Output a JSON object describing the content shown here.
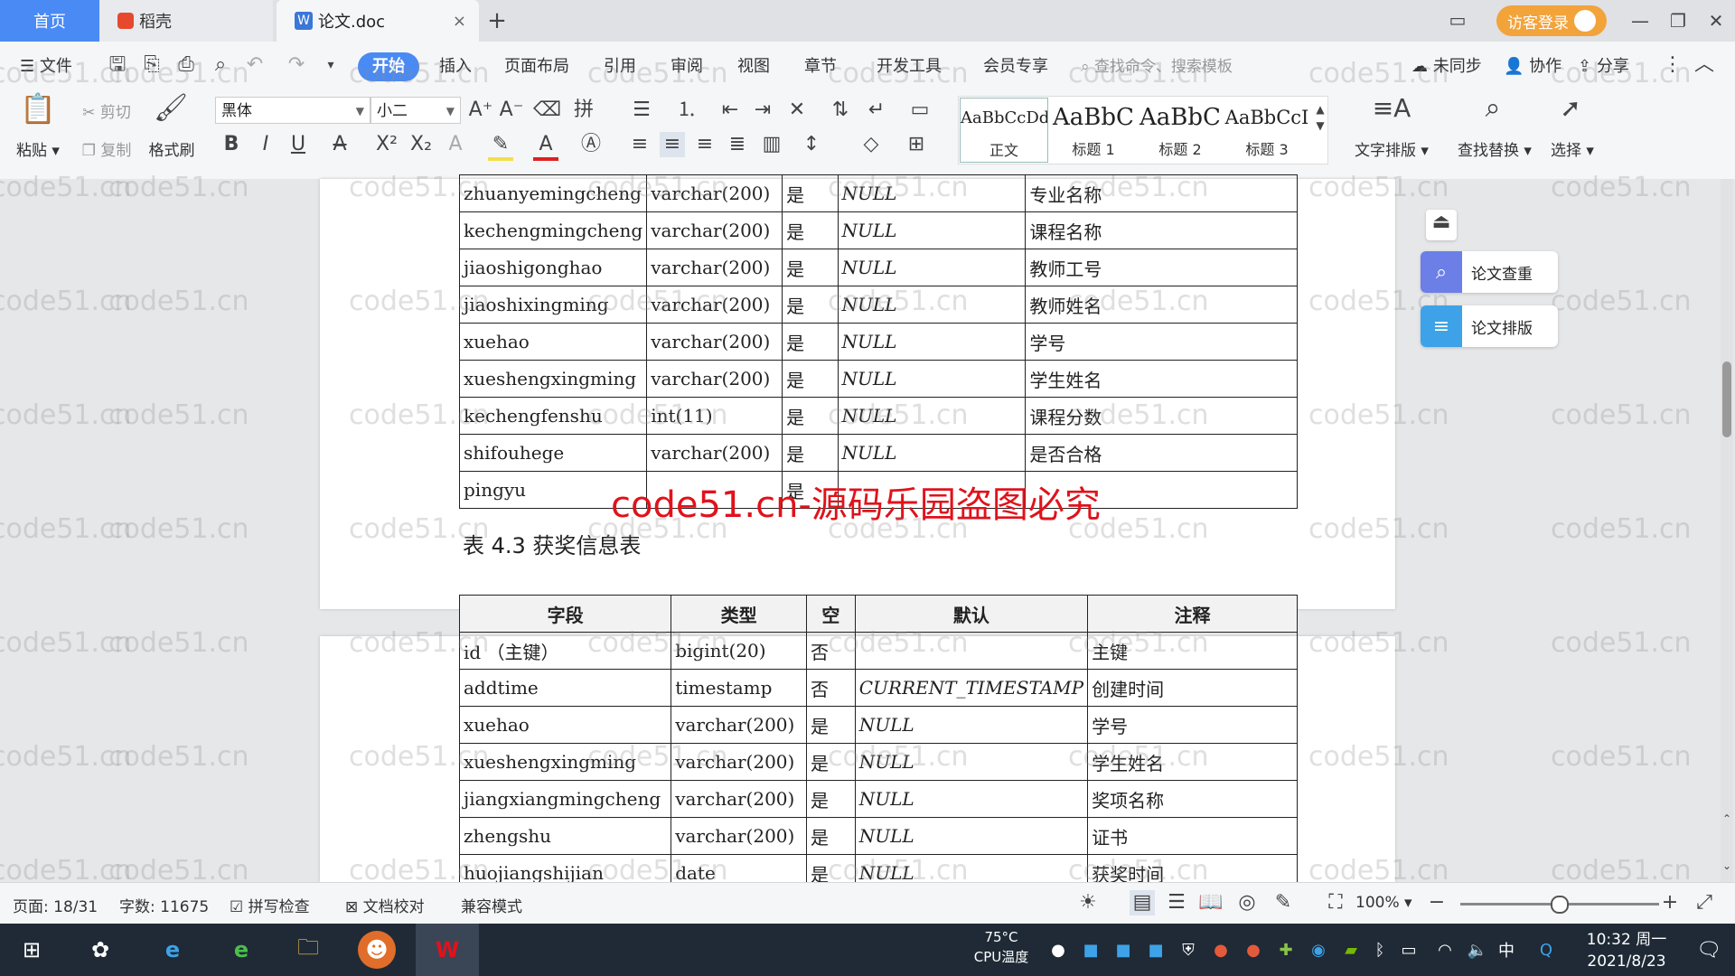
{
  "tabs": {
    "home": "首页",
    "daoke": "稻壳",
    "doc": "论文.doc",
    "add": "+"
  },
  "titlebar": {
    "visitor_login": "访客登录"
  },
  "menu": {
    "file": "文件",
    "start": "开始",
    "insert": "插入",
    "layout": "页面布局",
    "reference": "引用",
    "review": "审阅",
    "view": "视图",
    "chapter": "章节",
    "devtools": "开发工具",
    "member": "会员专享",
    "search_placeholder": "查找命令、搜索模板",
    "unsync": "未同步",
    "collab": "协作",
    "share": "分享"
  },
  "ribbon": {
    "paste": "粘贴",
    "cut": "剪切",
    "copy": "复制",
    "format_painter": "格式刷",
    "font_name": "黑体",
    "font_size": "小二",
    "styles": [
      {
        "sample": "AaBbCcDd",
        "label": "正文"
      },
      {
        "sample": "AaBbC",
        "label": "标题 1"
      },
      {
        "sample": "AaBbC",
        "label": "标题 2"
      },
      {
        "sample": "AaBbCcI",
        "label": "标题 3"
      }
    ],
    "text_layout": "文字排版",
    "find_replace": "查找替换",
    "select": "选择"
  },
  "side_panel": {
    "check": "论文查重",
    "format": "论文排版"
  },
  "table_top": {
    "rows": [
      [
        "zhuanyemingcheng",
        "varchar(200)",
        "是",
        "NULL",
        "专业名称"
      ],
      [
        "kechengmingcheng",
        "varchar(200)",
        "是",
        "NULL",
        "课程名称"
      ],
      [
        "jiaoshigonghao",
        "varchar(200)",
        "是",
        "NULL",
        "教师工号"
      ],
      [
        "jiaoshixingming",
        "varchar(200)",
        "是",
        "NULL",
        "教师姓名"
      ],
      [
        "xuehao",
        "varchar(200)",
        "是",
        "NULL",
        "学号"
      ],
      [
        "xueshengxingming",
        "varchar(200)",
        "是",
        "NULL",
        "学生姓名"
      ],
      [
        "kechengfenshu",
        "int(11)",
        "是",
        "NULL",
        "课程分数"
      ],
      [
        "shifouhege",
        "varchar(200)",
        "是",
        "NULL",
        "是否合格"
      ],
      [
        "pingyu",
        "",
        "是",
        "",
        ""
      ]
    ]
  },
  "table_caption": "表 4.3 获奖信息表",
  "table_bottom": {
    "headers": [
      "字段",
      "类型",
      "空",
      "默认",
      "注释"
    ],
    "rows": [
      [
        "id （主键）",
        "bigint(20)",
        "否",
        "",
        "主键"
      ],
      [
        "addtime",
        "timestamp",
        "否",
        "CURRENT_TIMESTAMP",
        "创建时间"
      ],
      [
        "xuehao",
        "varchar(200)",
        "是",
        "NULL",
        "学号"
      ],
      [
        "xueshengxingming",
        "varchar(200)",
        "是",
        "NULL",
        "学生姓名"
      ],
      [
        "jiangxiangmingcheng",
        "varchar(200)",
        "是",
        "NULL",
        "奖项名称"
      ],
      [
        "zhengshu",
        "varchar(200)",
        "是",
        "NULL",
        "证书"
      ],
      [
        "huojiangshijian",
        "date",
        "是",
        "NULL",
        "获奖时间"
      ]
    ]
  },
  "watermark": {
    "text": "code51.cn",
    "red_text": "code51.cn-源码乐园盗图必究"
  },
  "statusbar": {
    "page": "页面: 18/31",
    "word_count": "字数: 11675",
    "spell_check": "拼写检查",
    "doc_proof": "文档校对",
    "compat_mode": "兼容模式",
    "zoom": "100%",
    "zoom_level": 0.5
  },
  "taskbar": {
    "temp": "75°C",
    "cpu_temp": "CPU温度",
    "ime": "中",
    "time": "10:32 周一",
    "date": "2021/8/23"
  },
  "colors": {
    "accent": "#4a8af4",
    "visitor": "#f2a33a",
    "watermark_red": "#e0121b",
    "taskbar": "#1f2a36"
  }
}
